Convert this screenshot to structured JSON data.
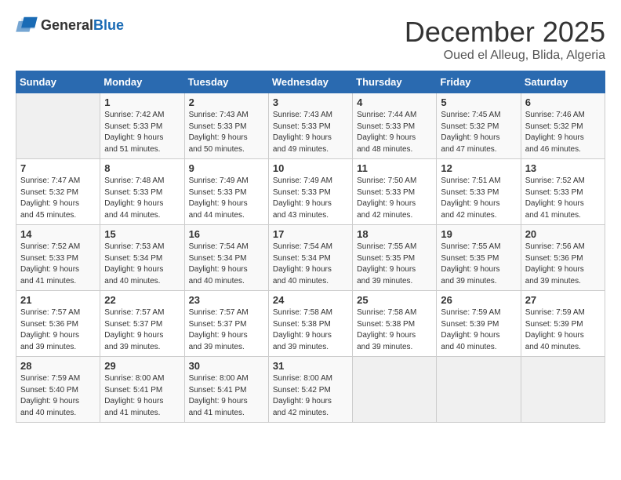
{
  "header": {
    "logo_general": "General",
    "logo_blue": "Blue",
    "month": "December 2025",
    "location": "Oued el Alleug, Blida, Algeria"
  },
  "days_of_week": [
    "Sunday",
    "Monday",
    "Tuesday",
    "Wednesday",
    "Thursday",
    "Friday",
    "Saturday"
  ],
  "weeks": [
    [
      {
        "day": null
      },
      {
        "day": 1,
        "sunrise": "Sunrise: 7:42 AM",
        "sunset": "Sunset: 5:33 PM",
        "daylight": "Daylight: 9 hours and 51 minutes."
      },
      {
        "day": 2,
        "sunrise": "Sunrise: 7:43 AM",
        "sunset": "Sunset: 5:33 PM",
        "daylight": "Daylight: 9 hours and 50 minutes."
      },
      {
        "day": 3,
        "sunrise": "Sunrise: 7:43 AM",
        "sunset": "Sunset: 5:33 PM",
        "daylight": "Daylight: 9 hours and 49 minutes."
      },
      {
        "day": 4,
        "sunrise": "Sunrise: 7:44 AM",
        "sunset": "Sunset: 5:33 PM",
        "daylight": "Daylight: 9 hours and 48 minutes."
      },
      {
        "day": 5,
        "sunrise": "Sunrise: 7:45 AM",
        "sunset": "Sunset: 5:32 PM",
        "daylight": "Daylight: 9 hours and 47 minutes."
      },
      {
        "day": 6,
        "sunrise": "Sunrise: 7:46 AM",
        "sunset": "Sunset: 5:32 PM",
        "daylight": "Daylight: 9 hours and 46 minutes."
      }
    ],
    [
      {
        "day": 7,
        "sunrise": "Sunrise: 7:47 AM",
        "sunset": "Sunset: 5:32 PM",
        "daylight": "Daylight: 9 hours and 45 minutes."
      },
      {
        "day": 8,
        "sunrise": "Sunrise: 7:48 AM",
        "sunset": "Sunset: 5:33 PM",
        "daylight": "Daylight: 9 hours and 44 minutes."
      },
      {
        "day": 9,
        "sunrise": "Sunrise: 7:49 AM",
        "sunset": "Sunset: 5:33 PM",
        "daylight": "Daylight: 9 hours and 44 minutes."
      },
      {
        "day": 10,
        "sunrise": "Sunrise: 7:49 AM",
        "sunset": "Sunset: 5:33 PM",
        "daylight": "Daylight: 9 hours and 43 minutes."
      },
      {
        "day": 11,
        "sunrise": "Sunrise: 7:50 AM",
        "sunset": "Sunset: 5:33 PM",
        "daylight": "Daylight: 9 hours and 42 minutes."
      },
      {
        "day": 12,
        "sunrise": "Sunrise: 7:51 AM",
        "sunset": "Sunset: 5:33 PM",
        "daylight": "Daylight: 9 hours and 42 minutes."
      },
      {
        "day": 13,
        "sunrise": "Sunrise: 7:52 AM",
        "sunset": "Sunset: 5:33 PM",
        "daylight": "Daylight: 9 hours and 41 minutes."
      }
    ],
    [
      {
        "day": 14,
        "sunrise": "Sunrise: 7:52 AM",
        "sunset": "Sunset: 5:33 PM",
        "daylight": "Daylight: 9 hours and 41 minutes."
      },
      {
        "day": 15,
        "sunrise": "Sunrise: 7:53 AM",
        "sunset": "Sunset: 5:34 PM",
        "daylight": "Daylight: 9 hours and 40 minutes."
      },
      {
        "day": 16,
        "sunrise": "Sunrise: 7:54 AM",
        "sunset": "Sunset: 5:34 PM",
        "daylight": "Daylight: 9 hours and 40 minutes."
      },
      {
        "day": 17,
        "sunrise": "Sunrise: 7:54 AM",
        "sunset": "Sunset: 5:34 PM",
        "daylight": "Daylight: 9 hours and 40 minutes."
      },
      {
        "day": 18,
        "sunrise": "Sunrise: 7:55 AM",
        "sunset": "Sunset: 5:35 PM",
        "daylight": "Daylight: 9 hours and 39 minutes."
      },
      {
        "day": 19,
        "sunrise": "Sunrise: 7:55 AM",
        "sunset": "Sunset: 5:35 PM",
        "daylight": "Daylight: 9 hours and 39 minutes."
      },
      {
        "day": 20,
        "sunrise": "Sunrise: 7:56 AM",
        "sunset": "Sunset: 5:36 PM",
        "daylight": "Daylight: 9 hours and 39 minutes."
      }
    ],
    [
      {
        "day": 21,
        "sunrise": "Sunrise: 7:57 AM",
        "sunset": "Sunset: 5:36 PM",
        "daylight": "Daylight: 9 hours and 39 minutes."
      },
      {
        "day": 22,
        "sunrise": "Sunrise: 7:57 AM",
        "sunset": "Sunset: 5:37 PM",
        "daylight": "Daylight: 9 hours and 39 minutes."
      },
      {
        "day": 23,
        "sunrise": "Sunrise: 7:57 AM",
        "sunset": "Sunset: 5:37 PM",
        "daylight": "Daylight: 9 hours and 39 minutes."
      },
      {
        "day": 24,
        "sunrise": "Sunrise: 7:58 AM",
        "sunset": "Sunset: 5:38 PM",
        "daylight": "Daylight: 9 hours and 39 minutes."
      },
      {
        "day": 25,
        "sunrise": "Sunrise: 7:58 AM",
        "sunset": "Sunset: 5:38 PM",
        "daylight": "Daylight: 9 hours and 39 minutes."
      },
      {
        "day": 26,
        "sunrise": "Sunrise: 7:59 AM",
        "sunset": "Sunset: 5:39 PM",
        "daylight": "Daylight: 9 hours and 40 minutes."
      },
      {
        "day": 27,
        "sunrise": "Sunrise: 7:59 AM",
        "sunset": "Sunset: 5:39 PM",
        "daylight": "Daylight: 9 hours and 40 minutes."
      }
    ],
    [
      {
        "day": 28,
        "sunrise": "Sunrise: 7:59 AM",
        "sunset": "Sunset: 5:40 PM",
        "daylight": "Daylight: 9 hours and 40 minutes."
      },
      {
        "day": 29,
        "sunrise": "Sunrise: 8:00 AM",
        "sunset": "Sunset: 5:41 PM",
        "daylight": "Daylight: 9 hours and 41 minutes."
      },
      {
        "day": 30,
        "sunrise": "Sunrise: 8:00 AM",
        "sunset": "Sunset: 5:41 PM",
        "daylight": "Daylight: 9 hours and 41 minutes."
      },
      {
        "day": 31,
        "sunrise": "Sunrise: 8:00 AM",
        "sunset": "Sunset: 5:42 PM",
        "daylight": "Daylight: 9 hours and 42 minutes."
      },
      {
        "day": null
      },
      {
        "day": null
      },
      {
        "day": null
      }
    ]
  ]
}
